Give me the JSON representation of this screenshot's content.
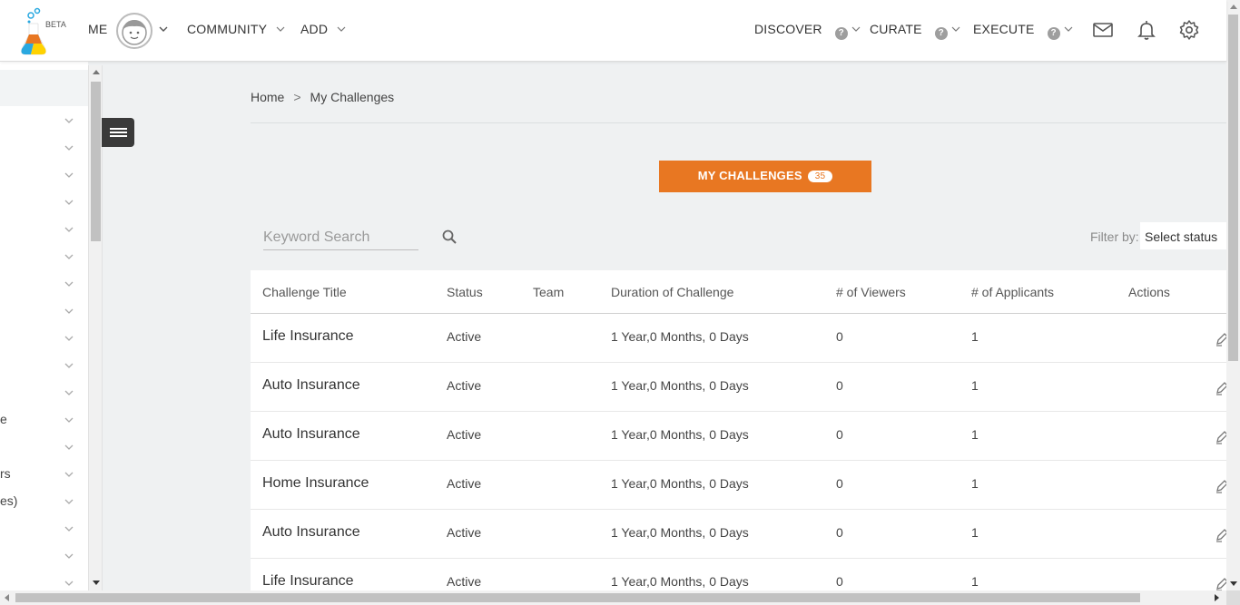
{
  "header": {
    "logo_badge": "BETA",
    "me_label": "ME",
    "community_label": "COMMUNITY",
    "add_label": "ADD",
    "discover_label": "DISCOVER",
    "curate_label": "CURATE",
    "execute_label": "EXECUTE",
    "help_glyph": "?"
  },
  "sidebar": {
    "partial_labels": [
      {
        "row": 11,
        "text": "e"
      },
      {
        "row": 13,
        "text": "rs"
      },
      {
        "row": 14,
        "text": "es)"
      }
    ]
  },
  "breadcrumb": {
    "home": "Home",
    "separator": ">",
    "current": "My Challenges"
  },
  "main": {
    "button_label": "MY CHALLENGES",
    "button_count": "35",
    "search_placeholder": "Keyword Search",
    "filter_label": "Filter by:",
    "filter_value": "Select status"
  },
  "table": {
    "columns": [
      "Challenge Title",
      "Status",
      "Team",
      "Duration of Challenge",
      "# of Viewers",
      "# of Applicants",
      "Actions"
    ],
    "rows": [
      {
        "title": "Life Insurance",
        "status": "Active",
        "team": "",
        "duration": "1 Year,0 Months, 0 Days",
        "viewers": "0",
        "applicants": "1"
      },
      {
        "title": "Auto Insurance",
        "status": "Active",
        "team": "",
        "duration": "1 Year,0 Months, 0 Days",
        "viewers": "0",
        "applicants": "1"
      },
      {
        "title": "Auto Insurance",
        "status": "Active",
        "team": "",
        "duration": "1 Year,0 Months, 0 Days",
        "viewers": "0",
        "applicants": "1"
      },
      {
        "title": "Home Insurance",
        "status": "Active",
        "team": "",
        "duration": "1 Year,0 Months, 0 Days",
        "viewers": "0",
        "applicants": "1"
      },
      {
        "title": "Auto Insurance",
        "status": "Active",
        "team": "",
        "duration": "1 Year,0 Months, 0 Days",
        "viewers": "0",
        "applicants": "1"
      },
      {
        "title": "Life Insurance",
        "status": "Active",
        "team": "",
        "duration": "1 Year,0 Months, 0 Days",
        "viewers": "0",
        "applicants": "1"
      }
    ]
  },
  "colors": {
    "accent": "#e87722",
    "background": "#eff1f2"
  },
  "icons": [
    "beaker-logo-icon",
    "avatar-icon",
    "chevron-down-icon",
    "help-icon",
    "mail-icon",
    "bell-icon",
    "gear-icon",
    "menu-icon",
    "search-icon",
    "edit-icon"
  ]
}
